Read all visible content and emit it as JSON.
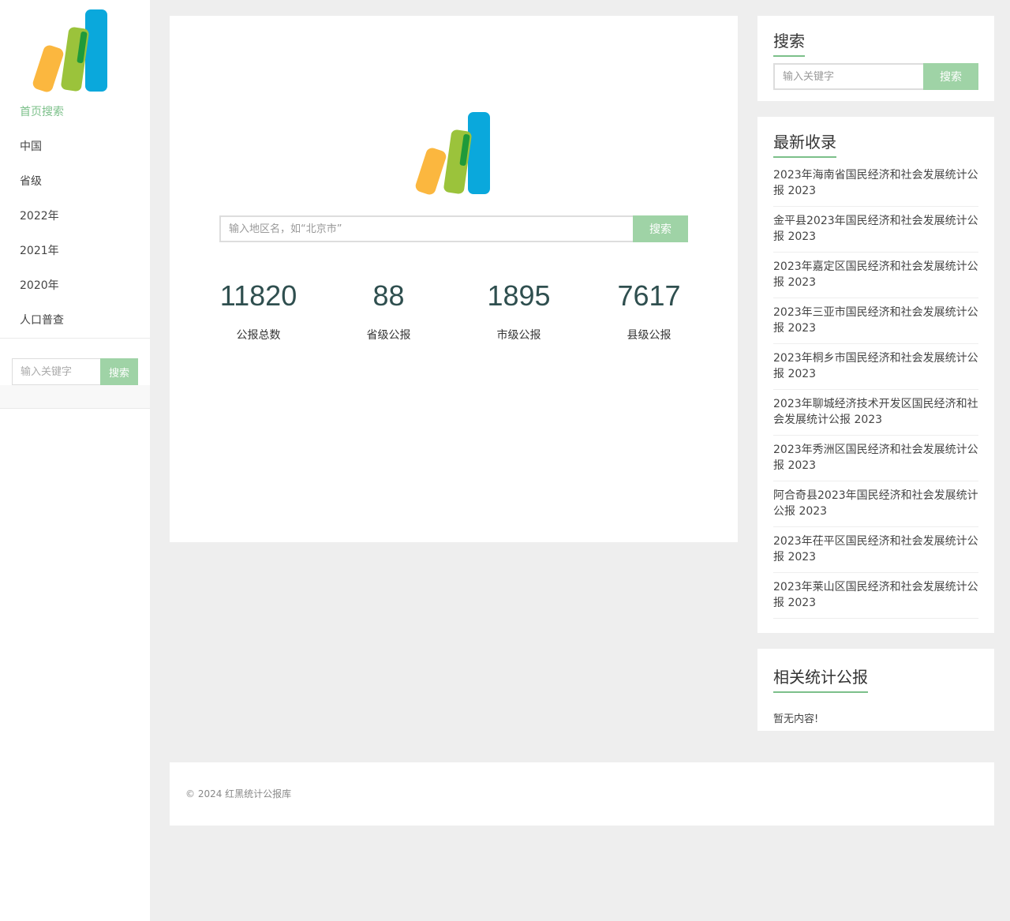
{
  "sidebar": {
    "nav": [
      {
        "label": "首页搜索",
        "active": true
      },
      {
        "label": "中国",
        "active": false
      },
      {
        "label": "省级",
        "active": false
      },
      {
        "label": "2022年",
        "active": false
      },
      {
        "label": "2021年",
        "active": false
      },
      {
        "label": "2020年",
        "active": false
      },
      {
        "label": "人口普查",
        "active": false
      }
    ],
    "search": {
      "placeholder": "输入关键字",
      "button": "搜索"
    }
  },
  "main": {
    "search": {
      "placeholder": "输入地区名，如“北京市”",
      "button": "搜索"
    },
    "stats": [
      {
        "value": "11820",
        "label": "公报总数"
      },
      {
        "value": "88",
        "label": "省级公报"
      },
      {
        "value": "1895",
        "label": "市级公报"
      },
      {
        "value": "7617",
        "label": "县级公报"
      }
    ]
  },
  "widgets": {
    "search": {
      "title": "搜索",
      "placeholder": "输入关键字",
      "button": "搜索"
    },
    "latest": {
      "title": "最新收录",
      "items": [
        "2023年海南省国民经济和社会发展统计公报 2023",
        "金平县2023年国民经济和社会发展统计公报 2023",
        "2023年嘉定区国民经济和社会发展统计公报 2023",
        "2023年三亚市国民经济和社会发展统计公报 2023",
        "2023年桐乡市国民经济和社会发展统计公报 2023",
        "2023年聊城经济技术开发区国民经济和社会发展统计公报 2023",
        "2023年秀洲区国民经济和社会发展统计公报 2023",
        "阿合奇县2023年国民经济和社会发展统计公报 2023",
        "2023年茌平区国民经济和社会发展统计公报 2023",
        "2023年莱山区国民经济和社会发展统计公报 2023"
      ]
    },
    "related": {
      "title": "相关统计公报",
      "empty": "暂无内容!"
    }
  },
  "footer": {
    "text": "© 2024 红黑统计公报库"
  },
  "colors": {
    "accent": "#7cc08a",
    "button": "#9fd3a6",
    "logo_orange": "#fbb73f",
    "logo_green": "#9bc33b",
    "logo_blue": "#0aa8dc"
  }
}
